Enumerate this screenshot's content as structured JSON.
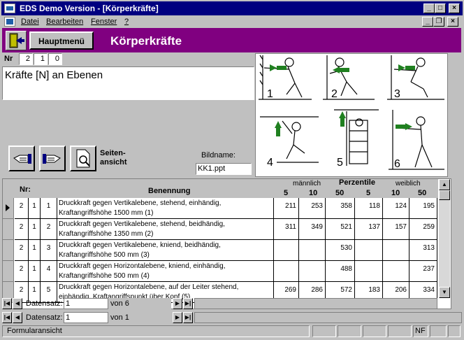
{
  "window": {
    "title": "EDS Demo Version - [Körperkräfte]",
    "minimize_glyph": "_",
    "maximize_glyph": "□",
    "close_glyph": "×",
    "mdi_minimize_glyph": "_",
    "mdi_restore_glyph": "❐",
    "mdi_close_glyph": "×"
  },
  "menu": {
    "items": [
      "Datei",
      "Bearbeiten",
      "Fenster",
      "?"
    ]
  },
  "header": {
    "main_menu_label": "Hauptmenü",
    "page_title": "Körperkräfte",
    "accent_color": "#800080"
  },
  "record": {
    "nr_label": "Nr",
    "nr_values": [
      "2",
      "1",
      "0"
    ],
    "description": "Kräfte [N] an Ebenen",
    "figure_labels": [
      "1",
      "2",
      "3",
      "4",
      "5",
      "6"
    ],
    "page_view_label_1": "Seiten-",
    "page_view_label_2": "ansicht",
    "image_name_label": "Bildname:",
    "image_name_value": "KK1.ppt"
  },
  "table": {
    "col_nr": "Nr:",
    "col_name": "Benennung",
    "group_male": "männlich",
    "group_perc": "Perzentile",
    "group_female": "weiblich",
    "percentiles": [
      "5",
      "10",
      "50",
      "5",
      "10",
      "50"
    ],
    "rows": [
      {
        "a": "2",
        "b": "1",
        "c": "1",
        "line1": "Druckkraft gegen Vertikalebene, stehend, einhändig,",
        "line2": "Kraftangriffshöhe 1500 mm (1)",
        "v": [
          "211",
          "253",
          "358",
          "118",
          "124",
          "195"
        ]
      },
      {
        "a": "2",
        "b": "1",
        "c": "2",
        "line1": "Druckkraft gegen Vertikalebene, stehend, beidhändig,",
        "line2": "Kraftangriffshöhe 1350 mm (2)",
        "v": [
          "311",
          "349",
          "521",
          "137",
          "157",
          "259"
        ]
      },
      {
        "a": "2",
        "b": "1",
        "c": "3",
        "line1": "Druckkraft gegen Vertikalebene, kniend, beidhändig,",
        "line2": "Kraftangriffshöhe 500 mm  (3)",
        "v": [
          "",
          "",
          "530",
          "",
          "",
          "313"
        ]
      },
      {
        "a": "2",
        "b": "1",
        "c": "4",
        "line1": "Druckkraft gegen Horizontalebene, kniend, einhändig,",
        "line2": "Kraftangriffshöhe 500 mm  (4)",
        "v": [
          "",
          "",
          "488",
          "",
          "",
          "237"
        ]
      },
      {
        "a": "2",
        "b": "1",
        "c": "5",
        "line1": "Druckkraft gegen Horizontalebene, auf der Leiter stehend,",
        "line2": "einhändig, Kraftangriffspunkt über Kopf  (5)",
        "v": [
          "269",
          "286",
          "572",
          "183",
          "206",
          "334"
        ]
      }
    ]
  },
  "nav_sub": {
    "label": "Datensatz:",
    "current": "1",
    "of_label": "von  6"
  },
  "nav_main": {
    "label": "Datensatz:",
    "current": "1",
    "of_label": "von  1"
  },
  "status": {
    "text": "Formularansicht",
    "nf": "NF"
  }
}
